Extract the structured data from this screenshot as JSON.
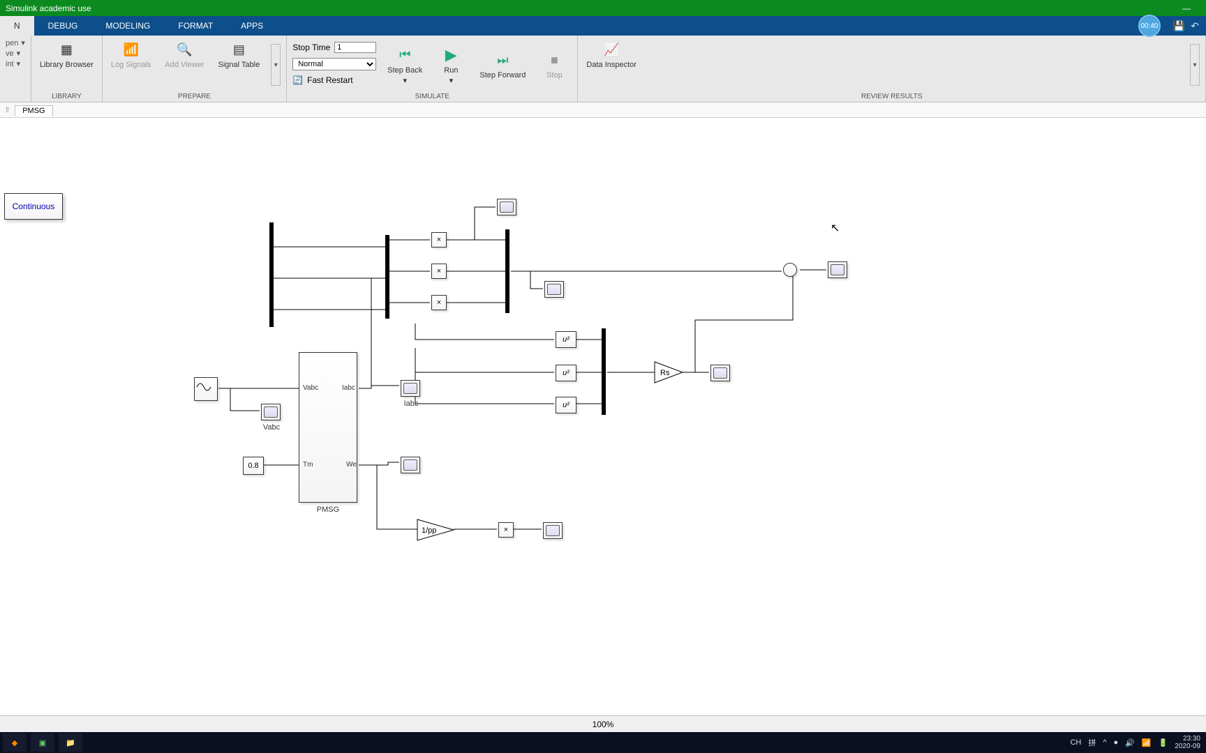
{
  "title": "Simulink academic use",
  "tabs": [
    "N",
    "DEBUG",
    "MODELING",
    "FORMAT",
    "APPS"
  ],
  "timer": "00:40",
  "ribbon": {
    "filecol": {
      "open": "pen",
      "save": "ve",
      "print": "int"
    },
    "library": {
      "label": "Library Browser",
      "group": "LIBRARY"
    },
    "prepare": {
      "log": "Log Signals",
      "add": "Add Viewer",
      "signal": "Signal Table",
      "group": "PREPARE"
    },
    "sim": {
      "stoptime_label": "Stop Time",
      "stoptime_val": "1",
      "mode": "Normal",
      "fast": "Fast Restart",
      "stepback": "Step Back",
      "run": "Run",
      "stepfwd": "Step Forward",
      "stop": "Stop",
      "group": "SIMULATE"
    },
    "review": {
      "data": "Data Inspector",
      "group": "REVIEW RESULTS"
    }
  },
  "breadcrumb": {
    "model": "PMSG"
  },
  "blocks": {
    "powergui": "Continuous",
    "const": "0.8",
    "pmsg_name": "PMSG",
    "pmsg_ports": {
      "vabc": "Vabc",
      "iabc": "Iabc",
      "tm": "Tm",
      "we": "We"
    },
    "vabc_scope": "Vabc",
    "iabc_scope": "Iabc",
    "mult": "×",
    "sq": "u²",
    "rs": "Rs",
    "invpp": "1/pp"
  },
  "status": {
    "zoom": "100%"
  },
  "taskbar": {
    "ime": "CH",
    "ime2": "拼",
    "time": "23:30",
    "date": "2020-09"
  }
}
